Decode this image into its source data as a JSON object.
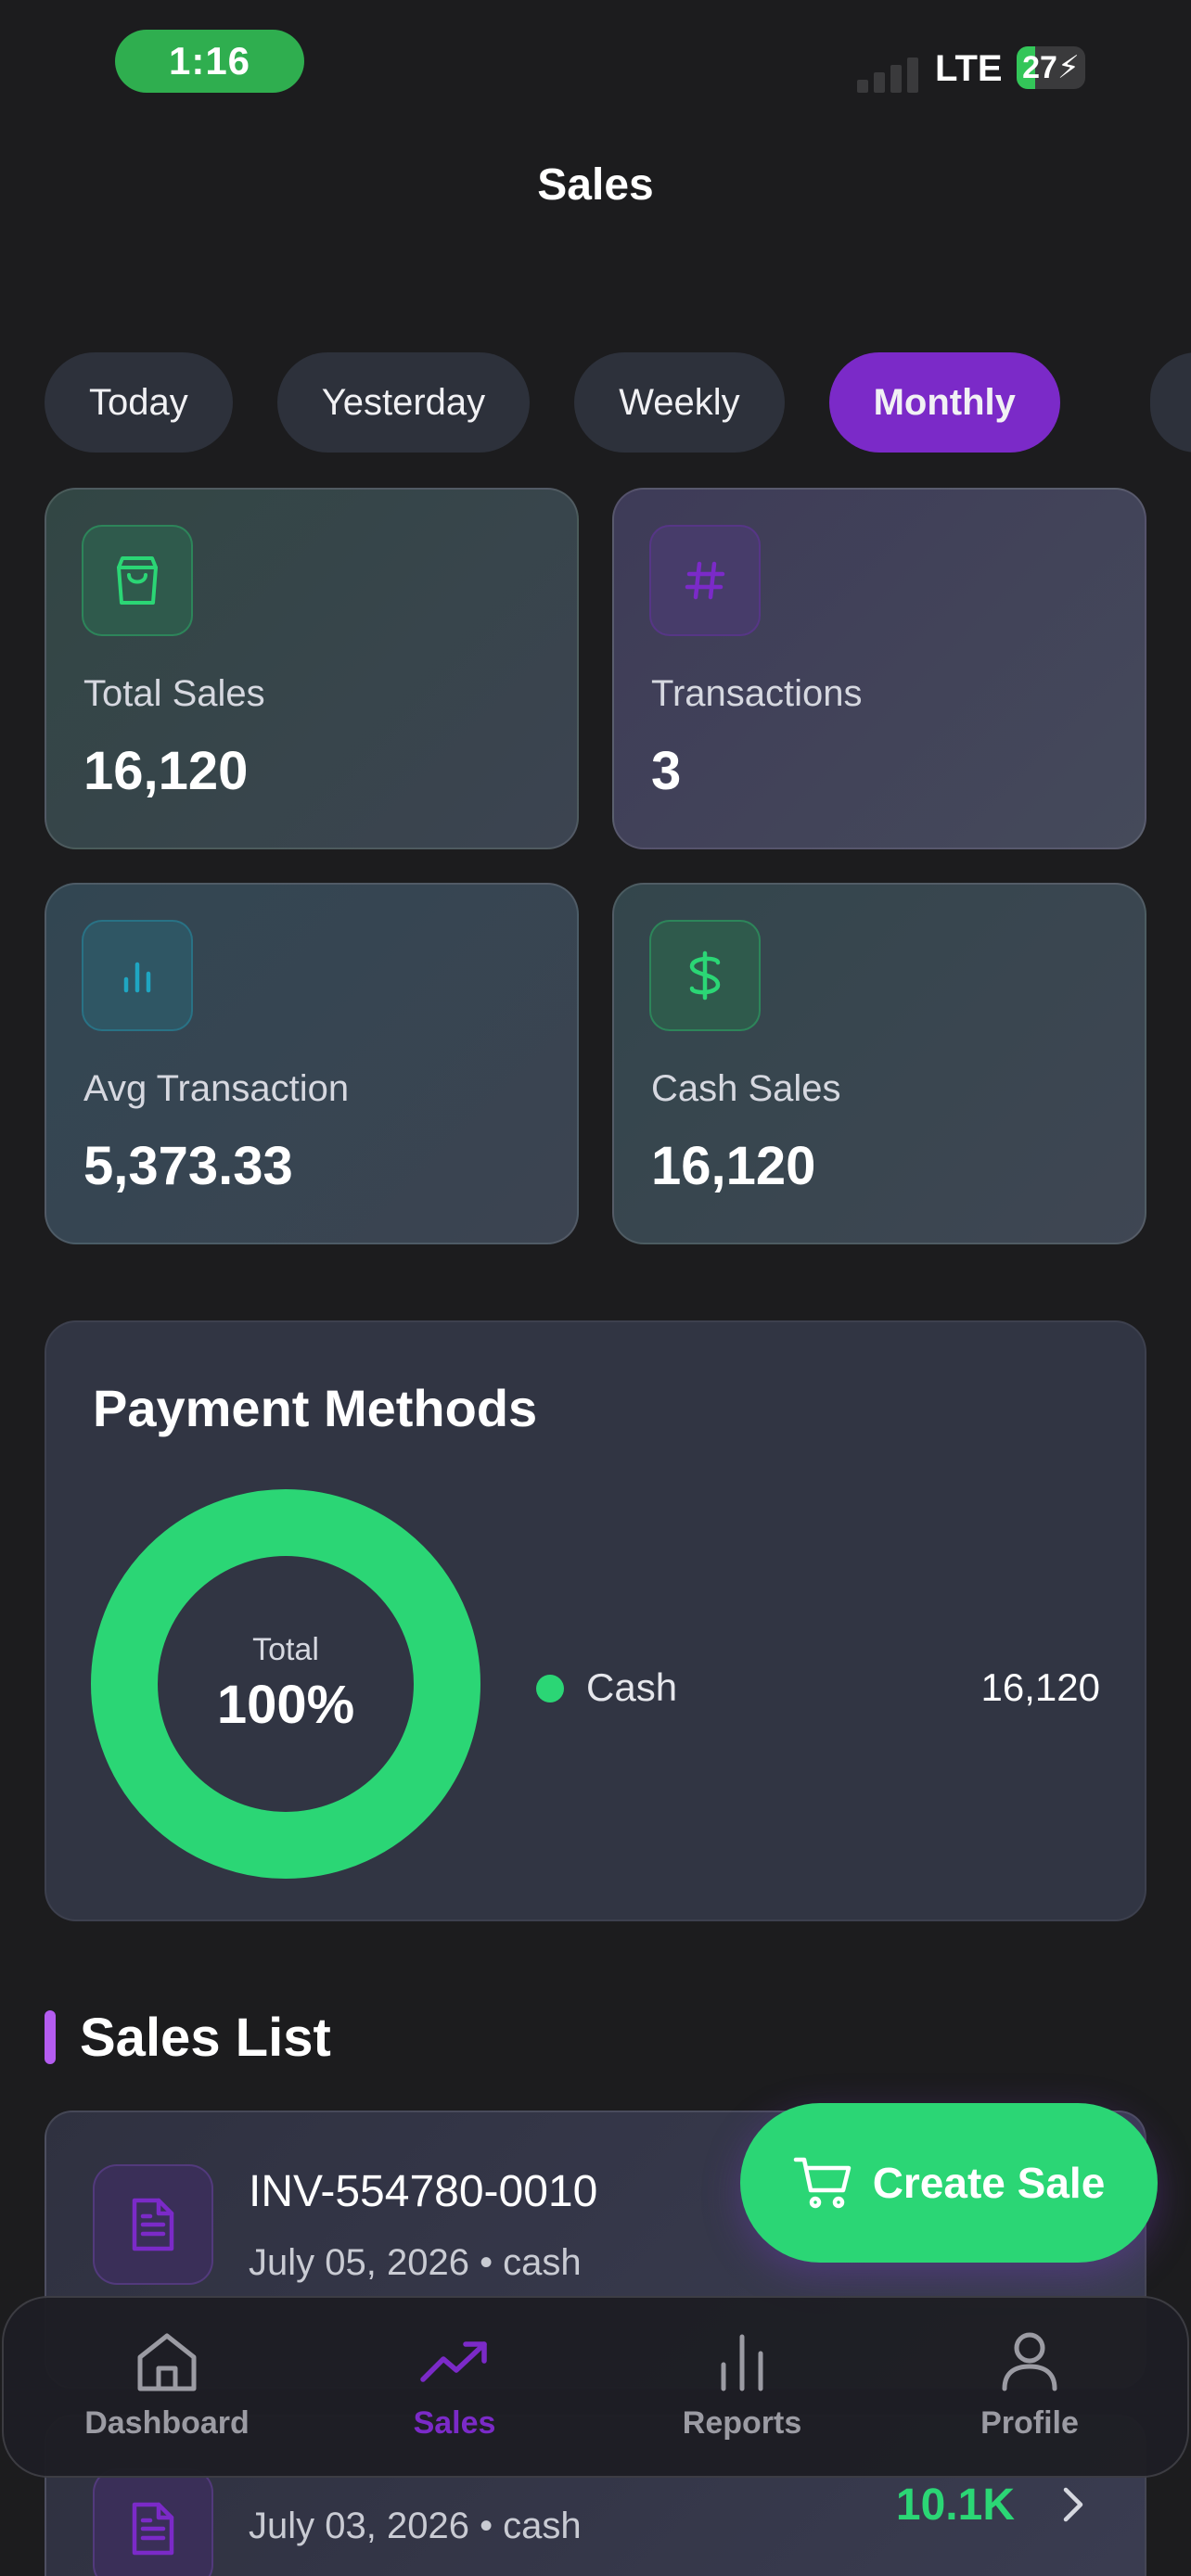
{
  "status_bar": {
    "time": "1:16",
    "network": "LTE",
    "battery": "27",
    "battery_level": 0.27
  },
  "header": {
    "title": "Sales"
  },
  "filters": {
    "tabs": [
      "Today",
      "Yesterday",
      "Weekly",
      "Monthly"
    ],
    "active": "Monthly"
  },
  "stats": [
    {
      "label": "Total Sales",
      "value": "16,120",
      "icon": "shopping-bag-icon",
      "color": "#2bd675"
    },
    {
      "label": "Transactions",
      "value": "3",
      "icon": "hash-icon",
      "color": "#7b2ac8"
    },
    {
      "label": "Avg Transaction",
      "value": "5,373.33",
      "icon": "bar-chart-icon",
      "color": "#1fa6c2"
    },
    {
      "label": "Cash Sales",
      "value": "16,120",
      "icon": "dollar-icon",
      "color": "#2bd675"
    }
  ],
  "payment_methods": {
    "title": "Payment Methods",
    "center_label": "Total",
    "center_value": "100%",
    "items": [
      {
        "name": "Cash",
        "value": "16,120",
        "share": 100,
        "color": "#2bd675"
      }
    ]
  },
  "sales_list": {
    "title": "Sales List",
    "items": [
      {
        "invoice": "INV-554780-0010",
        "meta": "July 05, 2026 • cash"
      },
      {
        "invoice": "",
        "meta": "July 03, 2026 • cash",
        "amount": "10.1K"
      }
    ]
  },
  "fab": {
    "label": "Create Sale"
  },
  "nav": {
    "items": [
      {
        "label": "Dashboard",
        "icon": "home-icon"
      },
      {
        "label": "Sales",
        "icon": "trending-up-icon",
        "active": true
      },
      {
        "label": "Reports",
        "icon": "bar-chart-icon"
      },
      {
        "label": "Profile",
        "icon": "user-icon"
      }
    ]
  },
  "colors": {
    "accent": "#7b2ac8",
    "success": "#2bd675",
    "background": "#1c1c1e"
  }
}
